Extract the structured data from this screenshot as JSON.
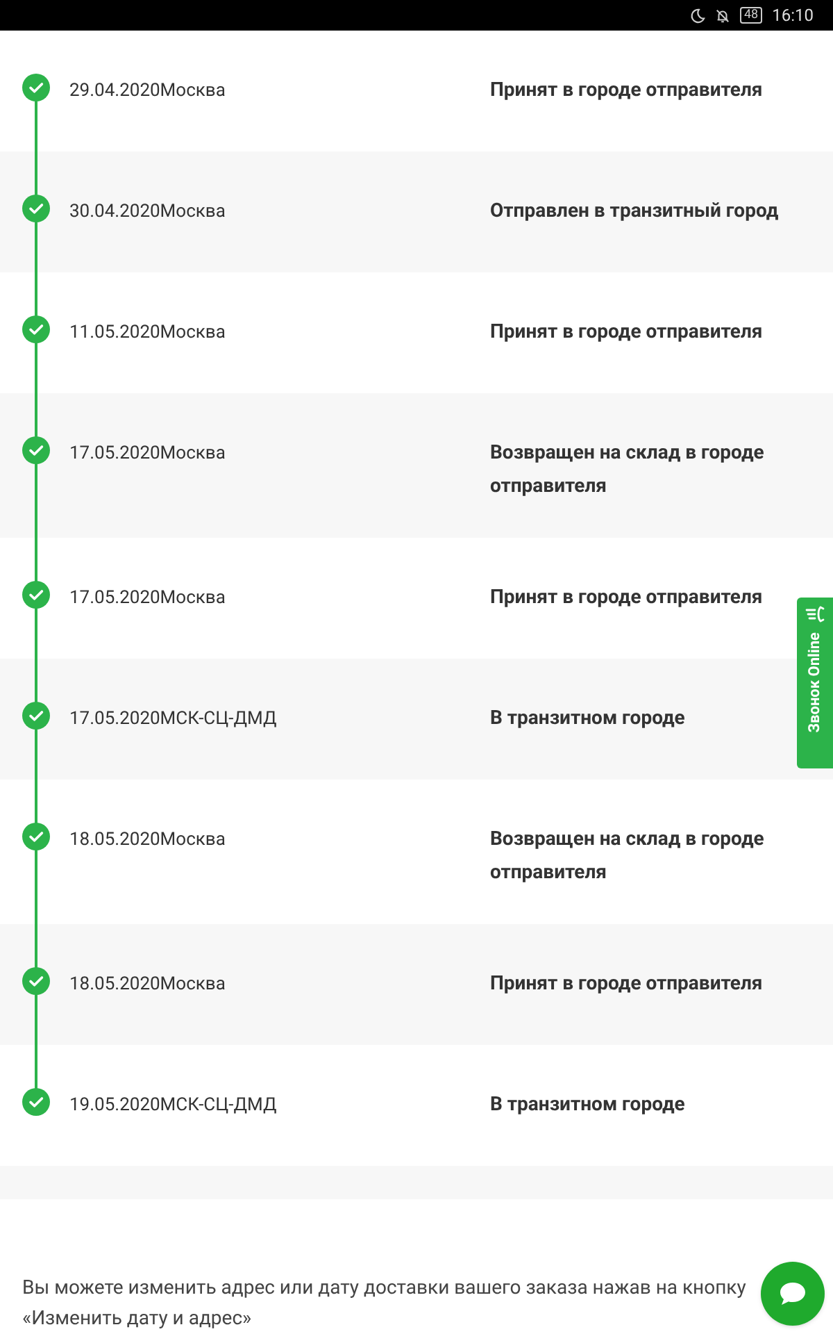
{
  "status_bar": {
    "battery": "48",
    "time": "16:10"
  },
  "events": [
    {
      "place": "29.04.2020Москва",
      "status": "Принят в городе отправителя",
      "done": true
    },
    {
      "place": "30.04.2020Москва",
      "status": "Отправлен в транзитный город",
      "done": true
    },
    {
      "place": "11.05.2020Москва",
      "status": "Принят в городе отправителя",
      "done": true
    },
    {
      "place": "17.05.2020Москва",
      "status": "Возвращен на склад в городе отправителя",
      "done": true
    },
    {
      "place": "17.05.2020Москва",
      "status": "Принят в городе отправителя",
      "done": true
    },
    {
      "place": "17.05.2020МСК-СЦ-ДМД",
      "status": "В транзитном городе",
      "done": true
    },
    {
      "place": "18.05.2020Москва",
      "status": "Возвращен на склад в городе отправителя",
      "done": true
    },
    {
      "place": "18.05.2020Москва",
      "status": "Принят в городе отправителя",
      "done": true
    },
    {
      "place": "19.05.2020МСК-СЦ-ДМД",
      "status": "В транзитном городе",
      "done": true
    }
  ],
  "notice": "Вы можете изменить адрес или дату доставки вашего заказа нажав на кнопку «Изменить дату и адрес»",
  "callback_tab": {
    "label": "Звонок Online"
  }
}
